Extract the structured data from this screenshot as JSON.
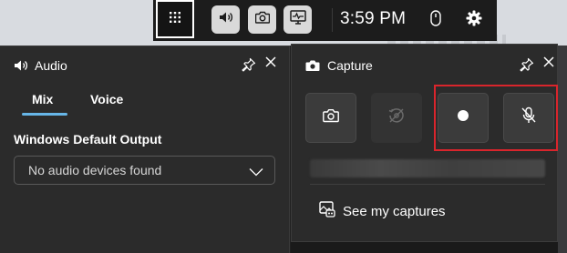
{
  "topbar": {
    "clock": "3:59 PM",
    "icons": [
      "widget-menu-icon",
      "audio-icon",
      "capture-icon",
      "performance-icon",
      "mouse-icon",
      "settings-icon"
    ]
  },
  "audio_panel": {
    "title": "Audio",
    "tabs": [
      {
        "label": "Mix",
        "selected": true
      },
      {
        "label": "Voice",
        "selected": false
      }
    ],
    "section_label": "Windows Default Output",
    "dropdown_value": "No audio devices found"
  },
  "capture_panel": {
    "title": "Capture",
    "buttons": [
      {
        "name": "screenshot",
        "enabled": true
      },
      {
        "name": "record-last-30s",
        "enabled": false
      },
      {
        "name": "start-recording",
        "enabled": true,
        "highlighted": true
      },
      {
        "name": "microphone-off",
        "enabled": true,
        "highlighted": true
      }
    ],
    "see_captures_label": "See my captures"
  },
  "colors": {
    "panel_bg": "#2b2b2b",
    "accent": "#67b6e8",
    "highlight_box": "#d9252c"
  }
}
